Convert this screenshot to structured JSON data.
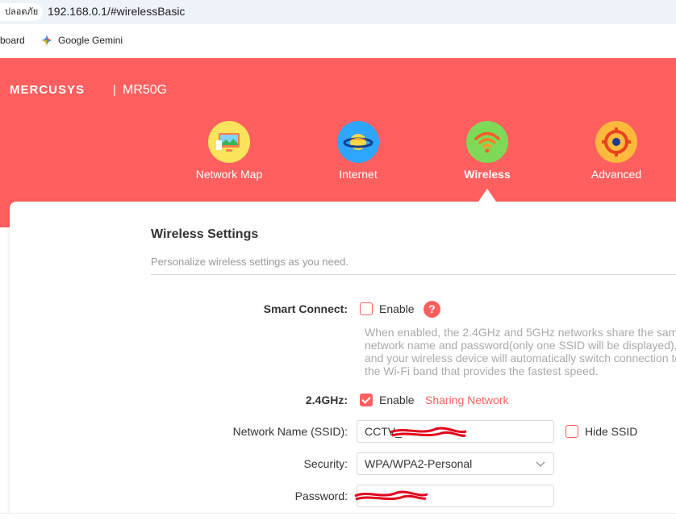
{
  "browser": {
    "tab_fragment": "ปลอดภัย",
    "url": "192.168.0.1/#wirelessBasic",
    "bookmarks": [
      {
        "label": "board"
      },
      {
        "label": "Google Gemini",
        "icon": "gemini-star-icon"
      }
    ]
  },
  "header": {
    "brand": "MERCUSYS",
    "separator": "|",
    "model": "MR50G",
    "bg_color": "#ff5f5f",
    "nav": [
      {
        "label": "Network Map",
        "icon": "network-map-icon",
        "active": false
      },
      {
        "label": "Internet",
        "icon": "globe-planet-icon",
        "active": false
      },
      {
        "label": "Wireless",
        "icon": "wifi-icon",
        "active": true
      },
      {
        "label": "Advanced",
        "icon": "gear-icon",
        "active": false
      }
    ]
  },
  "settings": {
    "title": "Wireless Settings",
    "subtitle": "Personalize wireless settings as you need.",
    "smart_connect": {
      "label": "Smart Connect:",
      "enable_label": "Enable",
      "checked": false,
      "help": "?",
      "description": [
        "When enabled, the 2.4GHz and 5GHz networks share the sam",
        "network name and password(only one SSID will be displayed),",
        "and your wireless device will automatically switch connection to",
        "the Wi-Fi band that provides the fastest speed."
      ]
    },
    "band_24": {
      "label": "2.4GHz:",
      "enable_label": "Enable",
      "checked": true,
      "sharing_link": "Sharing Network"
    },
    "ssid": {
      "label": "Network Name (SSID):",
      "value": "CCTV_",
      "hide_label": "Hide SSID",
      "hide_checked": false
    },
    "security": {
      "label": "Security:",
      "value": "WPA/WPA2-Personal"
    },
    "password": {
      "label": "Password:",
      "value": ""
    }
  },
  "colors": {
    "accent": "#ff5f5f",
    "redaction": "#e0001b"
  }
}
